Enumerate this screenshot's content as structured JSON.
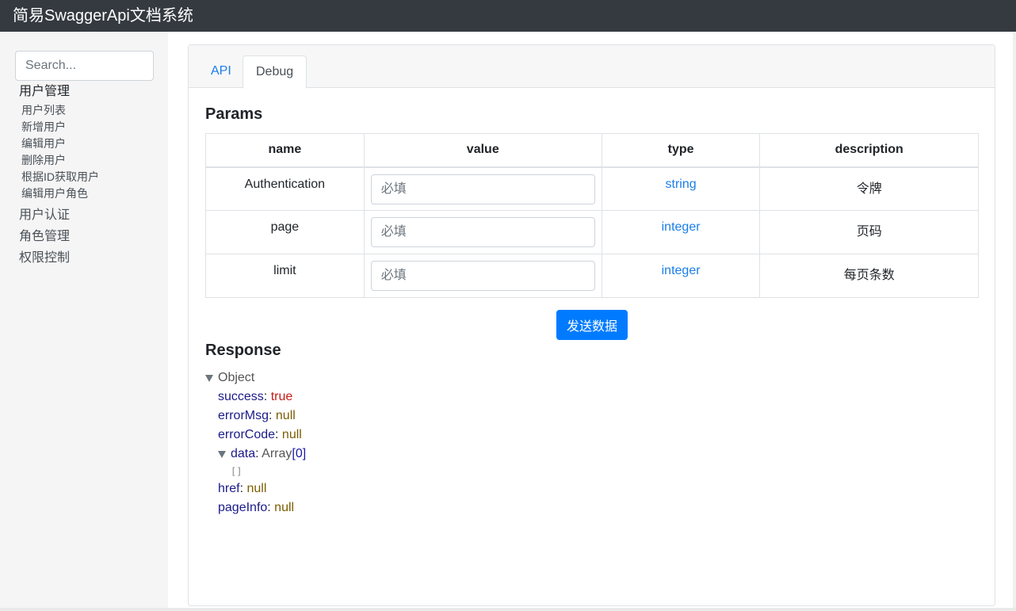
{
  "app": {
    "title": "简易SwaggerApi文档系统"
  },
  "sidebar": {
    "search_placeholder": "Search...",
    "groups": [
      {
        "label": "用户管理",
        "items": [
          "用户列表",
          "新增用户",
          "编辑用户",
          "删除用户",
          "根据ID获取用户",
          "编辑用户角色"
        ]
      },
      {
        "label": "用户认证"
      },
      {
        "label": "角色管理"
      },
      {
        "label": "权限控制"
      }
    ]
  },
  "tabs": {
    "api": "API",
    "debug": "Debug",
    "active": "Debug"
  },
  "params": {
    "title": "Params",
    "headers": [
      "name",
      "value",
      "type",
      "description"
    ],
    "rows": [
      {
        "name": "Authentication",
        "placeholder": "必填",
        "type": "string",
        "description": "令牌"
      },
      {
        "name": "page",
        "placeholder": "必填",
        "type": "integer",
        "description": "页码"
      },
      {
        "name": "limit",
        "placeholder": "必填",
        "type": "integer",
        "description": "每页条数"
      }
    ]
  },
  "send_button": "发送数据",
  "response": {
    "title": "Response",
    "root_label": "Object",
    "fields": {
      "success": {
        "key": "success",
        "value": "true"
      },
      "errorMsg": {
        "key": "errorMsg",
        "value": "null"
      },
      "errorCode": {
        "key": "errorCode",
        "value": "null"
      },
      "data": {
        "key": "data",
        "type": "Array",
        "count": "[0]",
        "empty": "[]"
      },
      "href": {
        "key": "href",
        "value": "null"
      },
      "pageInfo": {
        "key": "pageInfo",
        "value": "null"
      }
    }
  },
  "colors": {
    "topbar": "#343a40",
    "accent": "#007bff",
    "link": "#1a7ee8"
  }
}
